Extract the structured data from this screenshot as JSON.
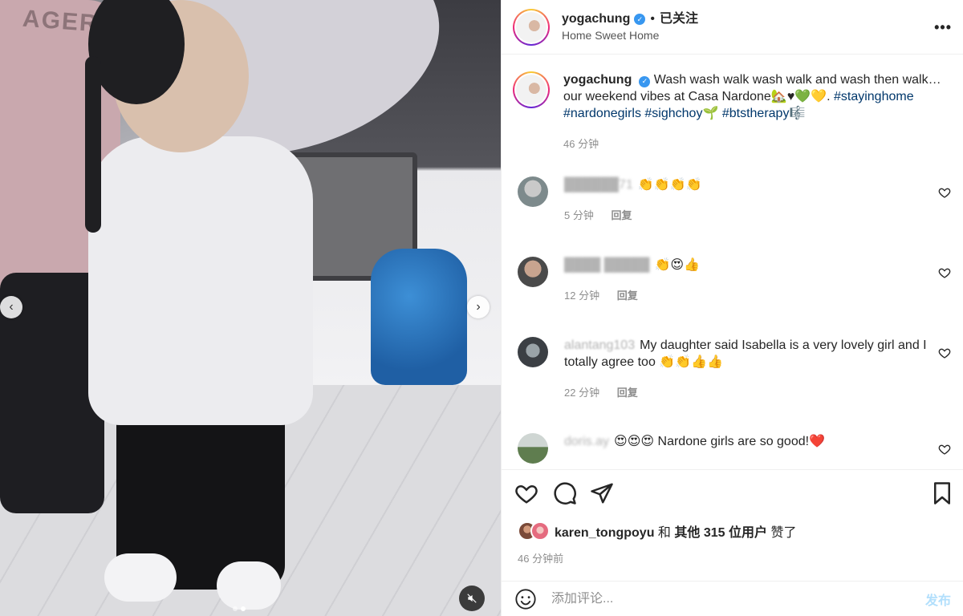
{
  "media": {
    "shirt_text": "AGER",
    "prev_label": "‹",
    "next_label": "›",
    "mute_icon": "speaker-muted-icon",
    "slides": 2,
    "active_slide": 2
  },
  "header": {
    "username": "yogachung",
    "follow_dot": "•",
    "follow_state": "已关注",
    "location": "Home Sweet Home",
    "more": "•••"
  },
  "caption": {
    "username": "yogachung",
    "text": "Wash wash walk wash walk and wash then walk…our weekend vibes at Casa Nardone🏡♥💚💛. ",
    "tags": [
      "#stayinghome",
      "#nardonegirls",
      "#sighchoy🌱",
      "#btstherapy🎼"
    ],
    "time": "46 分钟"
  },
  "comments": [
    {
      "user": "██████71",
      "text": "👏👏👏👏",
      "time": "5 分钟",
      "reply": "回复"
    },
    {
      "user": "████ █████",
      "text": "👏😍👍",
      "time": "12 分钟",
      "reply": "回复"
    },
    {
      "user": "alantang103",
      "text": "My daughter said Isabella is a very lovely girl and I totally agree too 👏👏👍👍",
      "time": "22 分钟",
      "reply": "回复"
    },
    {
      "user": "doris.ay",
      "text": "😍😍😍 Nardone girls are so good!❤️",
      "time": "",
      "reply": ""
    }
  ],
  "likes": {
    "first_user": "karen_tongpoyu",
    "joiner": "和",
    "others": "其他 315 位用户",
    "suffix": "赞了"
  },
  "post_time": "46 分钟前",
  "composer": {
    "placeholder": "添加评论...",
    "submit": "发布"
  },
  "colors": {
    "link": "#00376b",
    "verified": "#3897f0",
    "muted_text": "#8e8e8e",
    "post_disabled": "#b2dffc"
  }
}
